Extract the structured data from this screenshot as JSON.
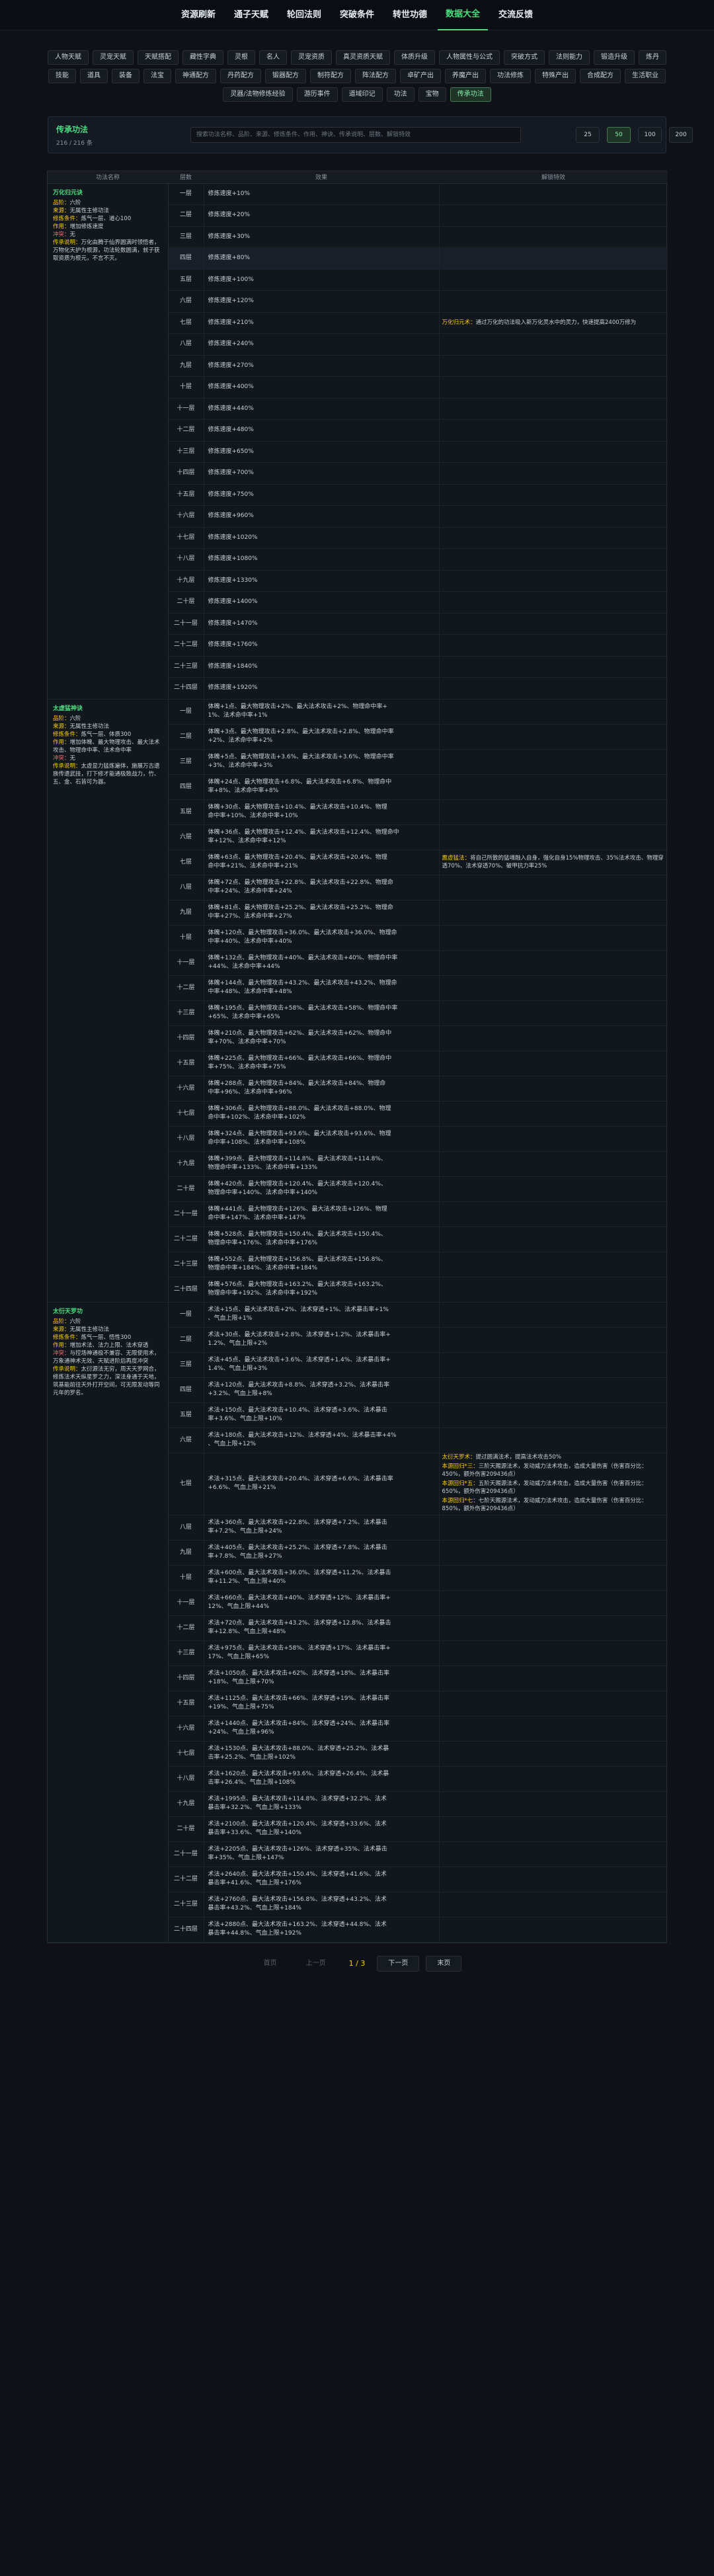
{
  "nav": [
    "资源刷新",
    "通子天赋",
    "轮回法则",
    "突破条件",
    "转世功德",
    "数据大全",
    "交流反馈"
  ],
  "nav_active": 5,
  "categories": [
    "人物天赋",
    "灵宠天赋",
    "天赋搭配",
    "藏性字典",
    "灵根",
    "名人",
    "灵宠资质",
    "真灵资质天赋",
    "体质升级",
    "人物属性与公式",
    "突破方式",
    "法则能力",
    "锻造升级",
    "炼丹",
    "技能",
    "道具",
    "装备",
    "法宝",
    "神通配方",
    "丹药配方",
    "锻器配方",
    "制符配方",
    "阵法配方",
    "卓矿产出",
    "养魔产出",
    "功法修炼",
    "特殊产出",
    "合成配方",
    "生活职业",
    "灵器/法物修炼经验",
    "游历事件",
    "道域印记",
    "功法",
    "宝物",
    "传承功法"
  ],
  "categories_active": 34,
  "panel": {
    "title": "传承功法",
    "count": "216 / 216 条",
    "search_placeholder": "搜索功法名称、品阶、来源、修炼条件、作用、神诀、传承说明、层数、解锁特效",
    "sizes": [
      "25",
      "50",
      "100",
      "200"
    ],
    "size_active": 1
  },
  "table_headers": {
    "name": "功法名称",
    "level": "层数",
    "effect": "效果",
    "unlock": "解锁特效"
  },
  "techniques": [
    {
      "name": "万化归元诀",
      "info": [
        {
          "k": "品阶：",
          "v": "六阶"
        },
        {
          "k": "来源：",
          "v": "无属性主修功法"
        },
        {
          "k": "修炼条件：",
          "v": "炼气一层、道心100"
        },
        {
          "k": "作用：",
          "v": "增加修炼速度"
        },
        {
          "k": "冲突：",
          "v": "无"
        },
        {
          "k": "传承说明：",
          "v": "万化由腾于仙界圆满时领悟者，万物化天护为根源，功法轮数圆满，就子获取资质为根元，不言不灭。"
        }
      ],
      "levels": [
        {
          "l": "一层",
          "e": [
            "修炼速度+10%"
          ]
        },
        {
          "l": "二层",
          "e": [
            "修炼速度+20%"
          ]
        },
        {
          "l": "三层",
          "e": [
            "修炼速度+30%"
          ]
        },
        {
          "l": "四层",
          "e": [
            "修炼速度+80%"
          ],
          "hl": true
        },
        {
          "l": "五层",
          "e": [
            "修炼速度+100%"
          ]
        },
        {
          "l": "六层",
          "e": [
            "修炼速度+120%"
          ]
        },
        {
          "l": "七层",
          "e": [
            "修炼速度+210%"
          ],
          "u": {
            "k": "万化归元术：",
            "v": "通过万化的功法吸入新万化灵水中的灵力，快速提高2400万修为"
          }
        },
        {
          "l": "八层",
          "e": [
            "修炼速度+240%"
          ]
        },
        {
          "l": "九层",
          "e": [
            "修炼速度+270%"
          ]
        },
        {
          "l": "十层",
          "e": [
            "修炼速度+400%"
          ]
        },
        {
          "l": "十一层",
          "e": [
            "修炼速度+440%"
          ]
        },
        {
          "l": "十二层",
          "e": [
            "修炼速度+480%"
          ]
        },
        {
          "l": "十三层",
          "e": [
            "修炼速度+650%"
          ]
        },
        {
          "l": "十四层",
          "e": [
            "修炼速度+700%"
          ]
        },
        {
          "l": "十五层",
          "e": [
            "修炼速度+750%"
          ]
        },
        {
          "l": "十六层",
          "e": [
            "修炼速度+960%"
          ]
        },
        {
          "l": "十七层",
          "e": [
            "修炼速度+1020%"
          ]
        },
        {
          "l": "十八层",
          "e": [
            "修炼速度+1080%"
          ]
        },
        {
          "l": "十九层",
          "e": [
            "修炼速度+1330%"
          ]
        },
        {
          "l": "二十层",
          "e": [
            "修炼速度+1400%"
          ]
        },
        {
          "l": "二十一层",
          "e": [
            "修炼速度+1470%"
          ]
        },
        {
          "l": "二十二层",
          "e": [
            "修炼速度+1760%"
          ]
        },
        {
          "l": "二十三层",
          "e": [
            "修炼速度+1840%"
          ]
        },
        {
          "l": "二十四层",
          "e": [
            "修炼速度+1920%"
          ]
        }
      ]
    },
    {
      "name": "太虚猛神诀",
      "info": [
        {
          "k": "品阶：",
          "v": "六阶"
        },
        {
          "k": "来源：",
          "v": "无属性主修功法"
        },
        {
          "k": "修炼条件：",
          "v": "炼气一层、体质300"
        },
        {
          "k": "作用：",
          "v": "增加体魄、最大物理攻击、最大法术攻击、物理命中率、法术命中率"
        },
        {
          "k": "冲突：",
          "v": "无"
        },
        {
          "k": "传承说明：",
          "v": "太虚显力猛炼遍体，施展万古遗族传遗武技，打下修才能通极致战力，竹、五、金、石皆可为器。"
        }
      ],
      "levels": [
        {
          "l": "一层",
          "e": [
            "体魄+1点、最大物理攻击+2%、最大法术攻击+2%、物理命中率+",
            "1%、法术命中率+1%"
          ]
        },
        {
          "l": "二层",
          "e": [
            "体魄+3点、最大物理攻击+2.8%、最大法术攻击+2.8%、物理命中率",
            "+2%、法术命中率+2%"
          ]
        },
        {
          "l": "三层",
          "e": [
            "体魄+5点、最大物理攻击+3.6%、最大法术攻击+3.6%、物理命中率",
            "+3%、法术命中率+3%"
          ]
        },
        {
          "l": "四层",
          "e": [
            "体魄+24点、最大物理攻击+6.8%、最大法术攻击+6.8%、物理命中",
            "率+8%、法术命中率+8%"
          ]
        },
        {
          "l": "五层",
          "e": [
            "体魄+30点、最大物理攻击+10.4%、最大法术攻击+10.4%、物理",
            "命中率+10%、法术命中率+10%"
          ]
        },
        {
          "l": "六层",
          "e": [
            "体魄+36点、最大物理攻击+12.4%、最大法术攻击+12.4%、物理命中",
            "率+12%、法术命中率+12%"
          ]
        },
        {
          "l": "七层",
          "e": [
            "体魄+63点、最大物理攻击+20.4%、最大法术攻击+20.4%、物理",
            "命中率+21%、法术命中率+21%"
          ],
          "u": {
            "k": "震虚猛法：",
            "v": "将自己所散的猛魂融入自身，强化自身15%物理攻击、35%法术攻击、物理穿透70%、法术穿透70%、破甲抗力率25%"
          }
        },
        {
          "l": "八层",
          "e": [
            "体魄+72点、最大物理攻击+22.8%、最大法术攻击+22.8%、物理命",
            "中率+24%、法术命中率+24%"
          ]
        },
        {
          "l": "九层",
          "e": [
            "体魄+81点、最大物理攻击+25.2%、最大法术攻击+25.2%、物理命",
            "中率+27%、法术命中率+27%"
          ]
        },
        {
          "l": "十层",
          "e": [
            "体魄+120点、最大物理攻击+36.0%、最大法术攻击+36.0%、物理命",
            "中率+40%、法术命中率+40%"
          ]
        },
        {
          "l": "十一层",
          "e": [
            "体魄+132点、最大物理攻击+40%、最大法术攻击+40%、物理命中率",
            "+44%、法术命中率+44%"
          ]
        },
        {
          "l": "十二层",
          "e": [
            "体魄+144点、最大物理攻击+43.2%、最大法术攻击+43.2%、物理命",
            "中率+48%、法术命中率+48%"
          ]
        },
        {
          "l": "十三层",
          "e": [
            "体魄+195点、最大物理攻击+58%、最大法术攻击+58%、物理命中率",
            "+65%、法术命中率+65%"
          ]
        },
        {
          "l": "十四层",
          "e": [
            "体魄+210点、最大物理攻击+62%、最大法术攻击+62%、物理命中",
            "率+70%、法术命中率+70%"
          ]
        },
        {
          "l": "十五层",
          "e": [
            "体魄+225点、最大物理攻击+66%、最大法术攻击+66%、物理命中",
            "率+75%、法术命中率+75%"
          ]
        },
        {
          "l": "十六层",
          "e": [
            "体魄+288点、最大物理攻击+84%、最大法术攻击+84%、物理命",
            "中率+96%、法术命中率+96%"
          ]
        },
        {
          "l": "十七层",
          "e": [
            "体魄+306点、最大物理攻击+88.0%、最大法术攻击+88.0%、物理",
            "命中率+102%、法术命中率+102%"
          ]
        },
        {
          "l": "十八层",
          "e": [
            "体魄+324点、最大物理攻击+93.6%、最大法术攻击+93.6%、物理",
            "命中率+108%、法术命中率+108%"
          ]
        },
        {
          "l": "十九层",
          "e": [
            "体魄+399点、最大物理攻击+114.8%、最大法术攻击+114.8%、",
            "物理命中率+133%、法术命中率+133%"
          ]
        },
        {
          "l": "二十层",
          "e": [
            "体魄+420点、最大物理攻击+120.4%、最大法术攻击+120.4%、",
            "物理命中率+140%、法术命中率+140%"
          ]
        },
        {
          "l": "二十一层",
          "e": [
            "体魄+441点、最大物理攻击+126%、最大法术攻击+126%、物理",
            "命中率+147%、法术命中率+147%"
          ]
        },
        {
          "l": "二十二层",
          "e": [
            "体魄+528点、最大物理攻击+150.4%、最大法术攻击+150.4%、",
            "物理命中率+176%、法术命中率+176%"
          ]
        },
        {
          "l": "二十三层",
          "e": [
            "体魄+552点、最大物理攻击+156.8%、最大法术攻击+156.8%、",
            "物理命中率+184%、法术命中率+184%"
          ]
        },
        {
          "l": "二十四层",
          "e": [
            "体魄+576点、最大物理攻击+163.2%、最大法术攻击+163.2%、",
            "物理命中率+192%、法术命中率+192%"
          ]
        }
      ]
    },
    {
      "name": "太衍天罗功",
      "info": [
        {
          "k": "品阶：",
          "v": "六阶"
        },
        {
          "k": "来源：",
          "v": "无属性主修功法"
        },
        {
          "k": "修炼条件：",
          "v": "炼气一层、悟性300"
        },
        {
          "k": "作用：",
          "v": "增加术法、法力上限、法术穿透"
        },
        {
          "k": "冲突：",
          "v": "与控场神通极不兼容、无限使用术，万象通神术无效、天赋进阶后再度冲突"
        },
        {
          "k": "传承说明：",
          "v": "太衍源法无穷，周天天罗网合，修炼法术天纵星罗之力，深法身通于天地，筑基能前往天外打开空间，可无限发动等同元年的罗名。"
        }
      ],
      "levels": [
        {
          "l": "一层",
          "e": [
            "术法+15点、最大法术攻击+2%、法术穿透+1%、法术暴击率+1%",
            "、气血上限+1%"
          ]
        },
        {
          "l": "二层",
          "e": [
            "术法+30点、最大法术攻击+2.8%、法术穿透+1.2%、法术暴击率+",
            "1.2%、气血上限+2%"
          ]
        },
        {
          "l": "三层",
          "e": [
            "术法+45点、最大法术攻击+3.6%、法术穿透+1.4%、法术暴击率+",
            "1.4%、气血上限+3%"
          ]
        },
        {
          "l": "四层",
          "e": [
            "术法+120点、最大法术攻击+8.8%、法术穿透+3.2%、法术暴击率",
            "+3.2%、气血上限+8%"
          ]
        },
        {
          "l": "五层",
          "e": [
            "术法+150点、最大法术攻击+10.4%、法术穿透+3.6%、法术暴击",
            "率+3.6%、气血上限+10%"
          ]
        },
        {
          "l": "六层",
          "e": [
            "术法+180点、最大法术攻击+12%、法术穿透+4%、法术暴击率+4%",
            "、气血上限+12%"
          ]
        },
        {
          "l": "七层",
          "e": [
            "术法+315点、最大法术攻击+20.4%、法术穿透+6.6%、法术暴击率",
            "+6.6%、气血上限+21%"
          ],
          "tall": true,
          "u3": [
            {
              "k": "太衍天罗术：",
              "v": "提过圆满法术，提高法术攻击50%"
            },
            {
              "k": "本源回归*三：",
              "v": "三阶天赐源法术，发动威力法术攻击，造成大量伤害（伤害百分比：450%，额外伤害209436点）"
            },
            {
              "k": "本源回归*五：",
              "v": "五阶天赐源法术，发动威力法术攻击，造成大量伤害（伤害百分比：650%，额外伤害209436点）"
            },
            {
              "k": "本源回归*七：",
              "v": "七阶天赐源法术，发动威力法术攻击，造成大量伤害（伤害百分比：850%，额外伤害209436点）"
            }
          ]
        },
        {
          "l": "八层",
          "e": [
            "术法+360点、最大法术攻击+22.8%、法术穿透+7.2%、法术暴击",
            "率+7.2%、气血上限+24%"
          ]
        },
        {
          "l": "九层",
          "e": [
            "术法+405点、最大法术攻击+25.2%、法术穿透+7.8%、法术暴击",
            "率+7.8%、气血上限+27%"
          ]
        },
        {
          "l": "十层",
          "e": [
            "术法+600点、最大法术攻击+36.0%、法术穿透+11.2%、法术暴击",
            "率+11.2%、气血上限+40%"
          ]
        },
        {
          "l": "十一层",
          "e": [
            "术法+660点、最大法术攻击+40%、法术穿透+12%、法术暴击率+",
            "12%、气血上限+44%"
          ]
        },
        {
          "l": "十二层",
          "e": [
            "术法+720点、最大法术攻击+43.2%、法术穿透+12.8%、法术暴击",
            "率+12.8%、气血上限+48%"
          ]
        },
        {
          "l": "十三层",
          "e": [
            "术法+975点、最大法术攻击+58%、法术穿透+17%、法术暴击率+",
            "17%、气血上限+65%"
          ]
        },
        {
          "l": "十四层",
          "e": [
            "术法+1050点、最大法术攻击+62%、法术穿透+18%、法术暴击率",
            "+18%、气血上限+70%"
          ]
        },
        {
          "l": "十五层",
          "e": [
            "术法+1125点、最大法术攻击+66%、法术穿透+19%、法术暴击率",
            "+19%、气血上限+75%"
          ]
        },
        {
          "l": "十六层",
          "e": [
            "术法+1440点、最大法术攻击+84%、法术穿透+24%、法术暴击率",
            "+24%、气血上限+96%"
          ]
        },
        {
          "l": "十七层",
          "e": [
            "术法+1530点、最大法术攻击+88.0%、法术穿透+25.2%、法术暴",
            "击率+25.2%、气血上限+102%"
          ]
        },
        {
          "l": "十八层",
          "e": [
            "术法+1620点、最大法术攻击+93.6%、法术穿透+26.4%、法术暴",
            "击率+26.4%、气血上限+108%"
          ]
        },
        {
          "l": "十九层",
          "e": [
            "术法+1995点、最大法术攻击+114.8%、法术穿透+32.2%、法术",
            "暴击率+32.2%、气血上限+133%"
          ]
        },
        {
          "l": "二十层",
          "e": [
            "术法+2100点、最大法术攻击+120.4%、法术穿透+33.6%、法术",
            "暴击率+33.6%、气血上限+140%"
          ]
        },
        {
          "l": "二十一层",
          "e": [
            "术法+2205点、最大法术攻击+126%、法术穿透+35%、法术暴击",
            "率+35%、气血上限+147%"
          ]
        },
        {
          "l": "二十二层",
          "e": [
            "术法+2640点、最大法术攻击+150.4%、法术穿透+41.6%、法术",
            "暴击率+41.6%、气血上限+176%"
          ]
        },
        {
          "l": "二十三层",
          "e": [
            "术法+2760点、最大法术攻击+156.8%、法术穿透+43.2%、法术",
            "暴击率+43.2%、气血上限+184%"
          ]
        },
        {
          "l": "二十四层",
          "e": [
            "术法+2880点、最大法术攻击+163.2%、法术穿透+44.8%、法术",
            "暴击率+44.8%、气血上限+192%"
          ]
        }
      ]
    }
  ],
  "pagination": {
    "first": "首页",
    "prev": "上一页",
    "info": "1 / 3",
    "next": "下一页",
    "last": "末页"
  }
}
